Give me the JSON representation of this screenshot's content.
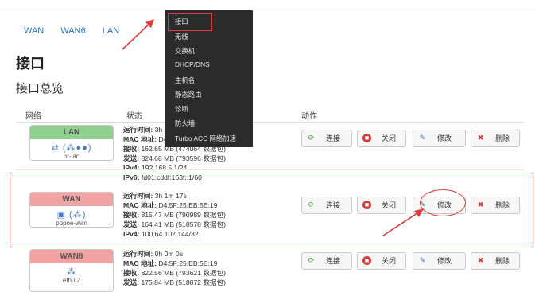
{
  "tabs": [
    "WAN",
    "WAN6",
    "LAN"
  ],
  "page": {
    "title": "接口",
    "subtitle": "接口总览"
  },
  "table": {
    "col_network": "网络",
    "col_status": "状态",
    "col_actions": "动作"
  },
  "menu": {
    "items": [
      "接口",
      "无线",
      "交换机",
      "DHCP/DNS",
      "主机名",
      "静态路由",
      "诊断",
      "防火墙",
      "Turbo ACC 网络加速"
    ]
  },
  "buttons": {
    "connect": "连接",
    "close": "关闭",
    "edit": "修改",
    "delete": "删除"
  },
  "interfaces": [
    {
      "name": "LAN",
      "device": "br-lan",
      "head_color": "#8fd08f",
      "status": [
        {
          "k": "运行时间:",
          "v": " 3h"
        },
        {
          "k": "MAC 地址:",
          "v": " D4"
        },
        {
          "k": "接收:",
          "v": " 162.65 MB (474064 数据包)"
        },
        {
          "k": "发送:",
          "v": " 824.68 MB (793596 数据包)"
        },
        {
          "k": "IPv4:",
          "v": " 192.168.5.1/24"
        },
        {
          "k": "IPv6:",
          "v": " fd01:cddf:163f::1/60"
        }
      ]
    },
    {
      "name": "WAN",
      "device": "pppoe-wan",
      "head_color": "#f2a3a3",
      "status": [
        {
          "k": "运行时间:",
          "v": " 3h 1m 17s"
        },
        {
          "k": "MAC 地址:",
          "v": " D4:5F:25:EB:5E:19"
        },
        {
          "k": "接收:",
          "v": " 815.47 MB (790989 数据包)"
        },
        {
          "k": "发送:",
          "v": " 164.41 MB (518578 数据包)"
        },
        {
          "k": "IPv4:",
          "v": " 100.64.102.144/32"
        }
      ]
    },
    {
      "name": "WAN6",
      "device": "eth0.2",
      "head_color": "#f2a3a3",
      "status": [
        {
          "k": "运行时间:",
          "v": " 0h 0m 0s"
        },
        {
          "k": "MAC 地址:",
          "v": " D4:5F:25:EB:5E:19"
        },
        {
          "k": "接收:",
          "v": " 822.56 MB (793621 数据包)"
        },
        {
          "k": "发送:",
          "v": " 175.84 MB (518872 数据包)"
        }
      ]
    }
  ]
}
